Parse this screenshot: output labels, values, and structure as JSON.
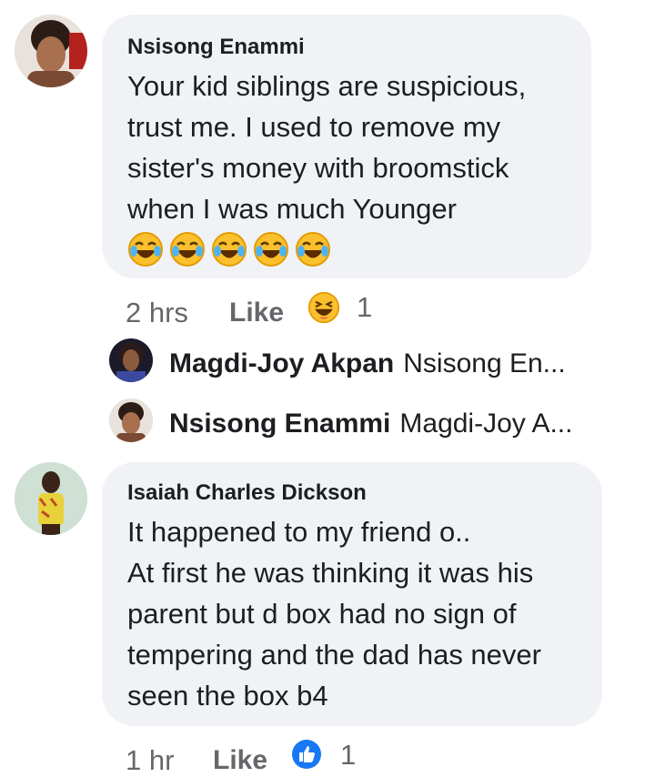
{
  "comments": [
    {
      "author": "Nsisong Enammi",
      "text": "Your kid siblings are suspicious,\ntrust me. I used to remove my\nsister's money with broomstick\nwhen I was much Younger",
      "emoji_count": 5,
      "time": "2 hrs",
      "like_label": "Like",
      "reaction": "laughing-emoji",
      "reaction_count": "1"
    },
    {
      "author": "Isaiah Charles Dickson",
      "text": "It happened to my friend o..\nAt first he was thinking it was his\nparent but d box had no sign of\ntempering and the dad has never\nseen the box b4",
      "time": "1 hr",
      "like_label": "Like",
      "reaction": "thumbs-up-icon",
      "reaction_count": "1"
    }
  ],
  "replies": [
    {
      "name": "Magdi-Joy Akpan",
      "preview": "Nsisong En..."
    },
    {
      "name": "Nsisong Enammi",
      "preview": "Magdi-Joy A..."
    }
  ],
  "colors": {
    "bubble": "#f0f2f5",
    "meta": "#65676b",
    "like_blue": "#1877f2",
    "emoji_yellow": "#fbc02d"
  }
}
